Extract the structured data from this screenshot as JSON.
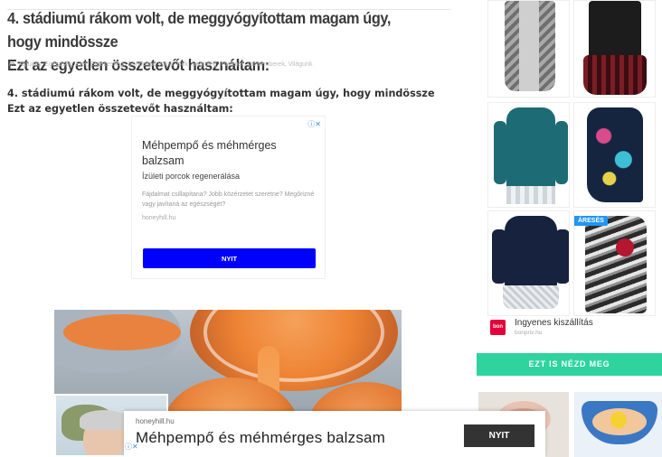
{
  "article": {
    "title_line1": "4. stádiumú rákom volt, de meggyógyítottam magam úgy, hogy mindössze",
    "title_line2": "Ezt az egyetlen összetevőt használtam:",
    "meta_prefix": "in",
    "categories": "Aktuális, Egészség, Élet, Érdekesség, Gondoltad volna, Nők, Segítség, Történet, Utcaemberek, Világunk",
    "lead_text": "4. stádiumú rákom volt, de meggyógyítottam magam úgy, hogy mindössze Ezt az egyetlen összetevőt használtam:"
  },
  "inline_ad": {
    "choices_icon": "ⓘ✕",
    "title": "Méhpempő és méhmérges balzsam",
    "subtitle": "Ízületi porcok regenerálása",
    "body": "Fájdalmat csillapítana? Jobb közérzetet szeretne? Megőrizné vagy javítaná az egészségét?",
    "domain": "honeyhill.hu",
    "button_label": "NYIT",
    "button_color": "#0000ff"
  },
  "sidebar": {
    "badge_label": "ÁRESÉS",
    "sponsor_name": "Ingyenes kiszállítás",
    "sponsor_domain": "bonprix.hu",
    "sponsor_logo_text": "bon prix",
    "cta_label": "EZT IS NÉZD MEG",
    "cta_color": "#2ed39e"
  },
  "sticky_ad": {
    "domain": "honeyhill.hu",
    "title": "Méhpempő és méhmérges balzsam",
    "button_label": "NYIT",
    "choices_icon": "ⓘ✕"
  }
}
